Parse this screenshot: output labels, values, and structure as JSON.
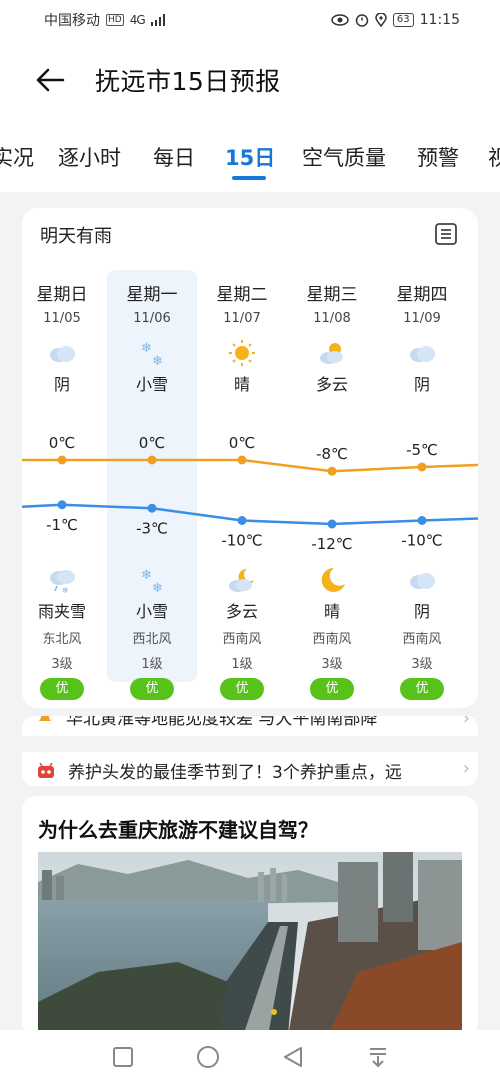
{
  "status_bar": {
    "carrier": "中国移动",
    "hd": "HD",
    "network": "4G",
    "battery": "63",
    "time": "11:15"
  },
  "header": {
    "title": "抚远市15日预报"
  },
  "tabs": [
    {
      "label": "实况",
      "active": false
    },
    {
      "label": "逐小时",
      "active": false
    },
    {
      "label": "每日",
      "active": false
    },
    {
      "label": "15日",
      "active": true
    },
    {
      "label": "空气质量",
      "active": false
    },
    {
      "label": "预警",
      "active": false
    },
    {
      "label": "视",
      "active": false
    }
  ],
  "forecast": {
    "summary": "明天有雨",
    "days": [
      {
        "name": "星期日",
        "date": "11/05",
        "day_weather": "阴",
        "day_icon": "cloud-icon",
        "high": "0℃",
        "low": "-1℃",
        "night_icon": "sleet-icon",
        "night_weather": "雨夹雪",
        "wind": "东北风",
        "level": "3级",
        "aqi": "优"
      },
      {
        "name": "星期一",
        "date": "11/06",
        "day_weather": "小雪",
        "day_icon": "snow-icon",
        "high": "0℃",
        "low": "-3℃",
        "night_icon": "snow-icon",
        "night_weather": "小雪",
        "wind": "西北风",
        "level": "1级",
        "aqi": "优"
      },
      {
        "name": "星期二",
        "date": "11/07",
        "day_weather": "晴",
        "day_icon": "sun-icon",
        "high": "0℃",
        "low": "-10℃",
        "night_icon": "moon-cloud-icon",
        "night_weather": "多云",
        "wind": "西南风",
        "level": "1级",
        "aqi": "优"
      },
      {
        "name": "星期三",
        "date": "11/08",
        "day_weather": "多云",
        "day_icon": "sun-cloud-icon",
        "high": "-8℃",
        "low": "-12℃",
        "night_icon": "moon-icon",
        "night_weather": "晴",
        "wind": "西南风",
        "level": "3级",
        "aqi": "优"
      },
      {
        "name": "星期四",
        "date": "11/09",
        "day_weather": "阴",
        "day_icon": "cloud-icon",
        "high": "-5℃",
        "low": "-10℃",
        "night_icon": "cloud-icon",
        "night_weather": "阴",
        "wind": "西南风",
        "level": "3级",
        "aqi": "优"
      }
    ],
    "high_values": [
      0,
      0,
      0,
      -8,
      -5
    ],
    "low_values": [
      -1,
      -3,
      -10,
      -12,
      -10
    ],
    "colors": {
      "high": "#f0a020",
      "low": "#3a8ee6",
      "aqi": "#57c21a",
      "selected": "#eef4fc"
    }
  },
  "news": [
    {
      "text": "华北黄淮等地能见度较差 与大平南南部降",
      "icon": "bell-icon"
    },
    {
      "text": "养护头发的最佳季节到了！3个养护重点，远",
      "icon": "robot-icon"
    }
  ],
  "article": {
    "title": "为什么去重庆旅游不建议自驾？"
  }
}
